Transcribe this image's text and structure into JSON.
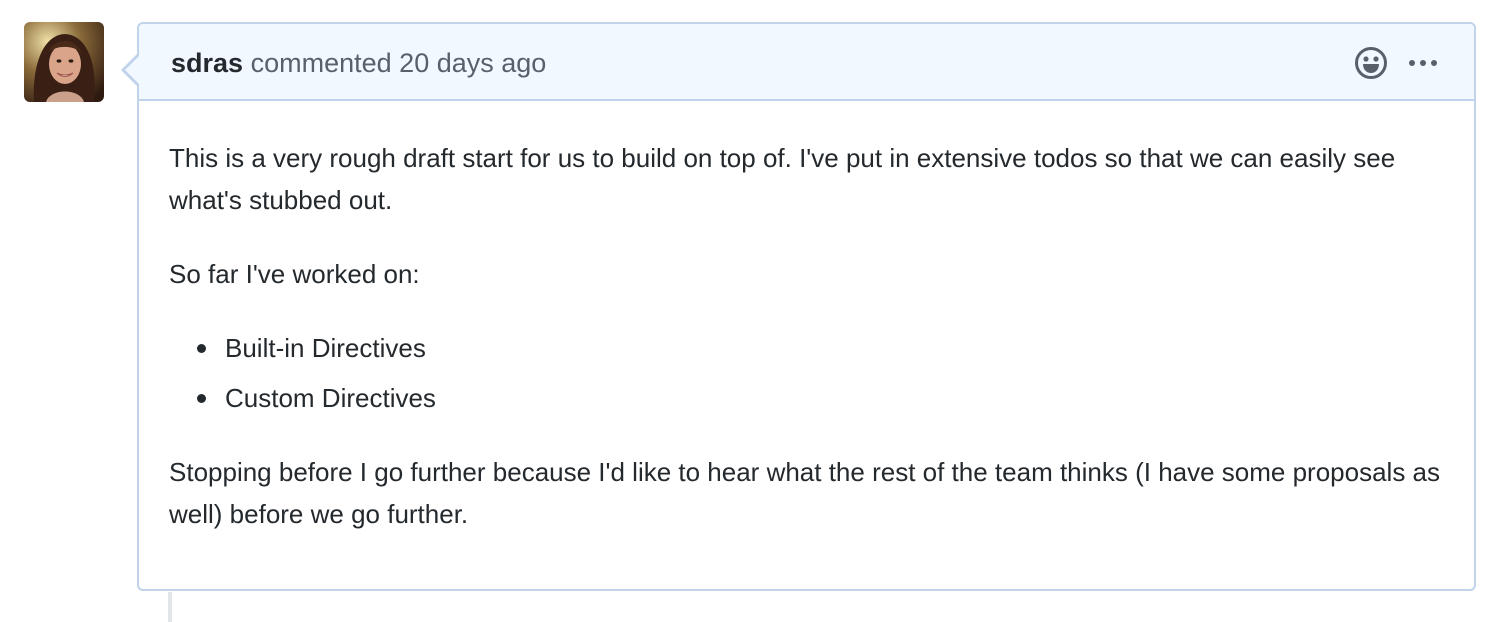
{
  "comment": {
    "author": "sdras",
    "action": "commented",
    "time": "20 days ago",
    "avatar_alt": "sdras avatar",
    "icons": {
      "reaction": "smiley-icon",
      "more": "kebab-horizontal-icon"
    },
    "body": {
      "paragraph1": "This is a very rough draft start for us to build on top of. I've put in extensive todos so that we can easily see what's stubbed out.",
      "paragraph2": "So far I've worked on:",
      "list": [
        "Built-in Directives",
        "Custom Directives"
      ],
      "paragraph3": "Stopping before I go further because I'd like to hear what the rest of the team thinks (I have some proposals as well) before we go further."
    }
  },
  "colors": {
    "header_bg": "#f1f8ff",
    "border": "#c0d3eb",
    "text": "#24292e",
    "muted": "#586069"
  }
}
